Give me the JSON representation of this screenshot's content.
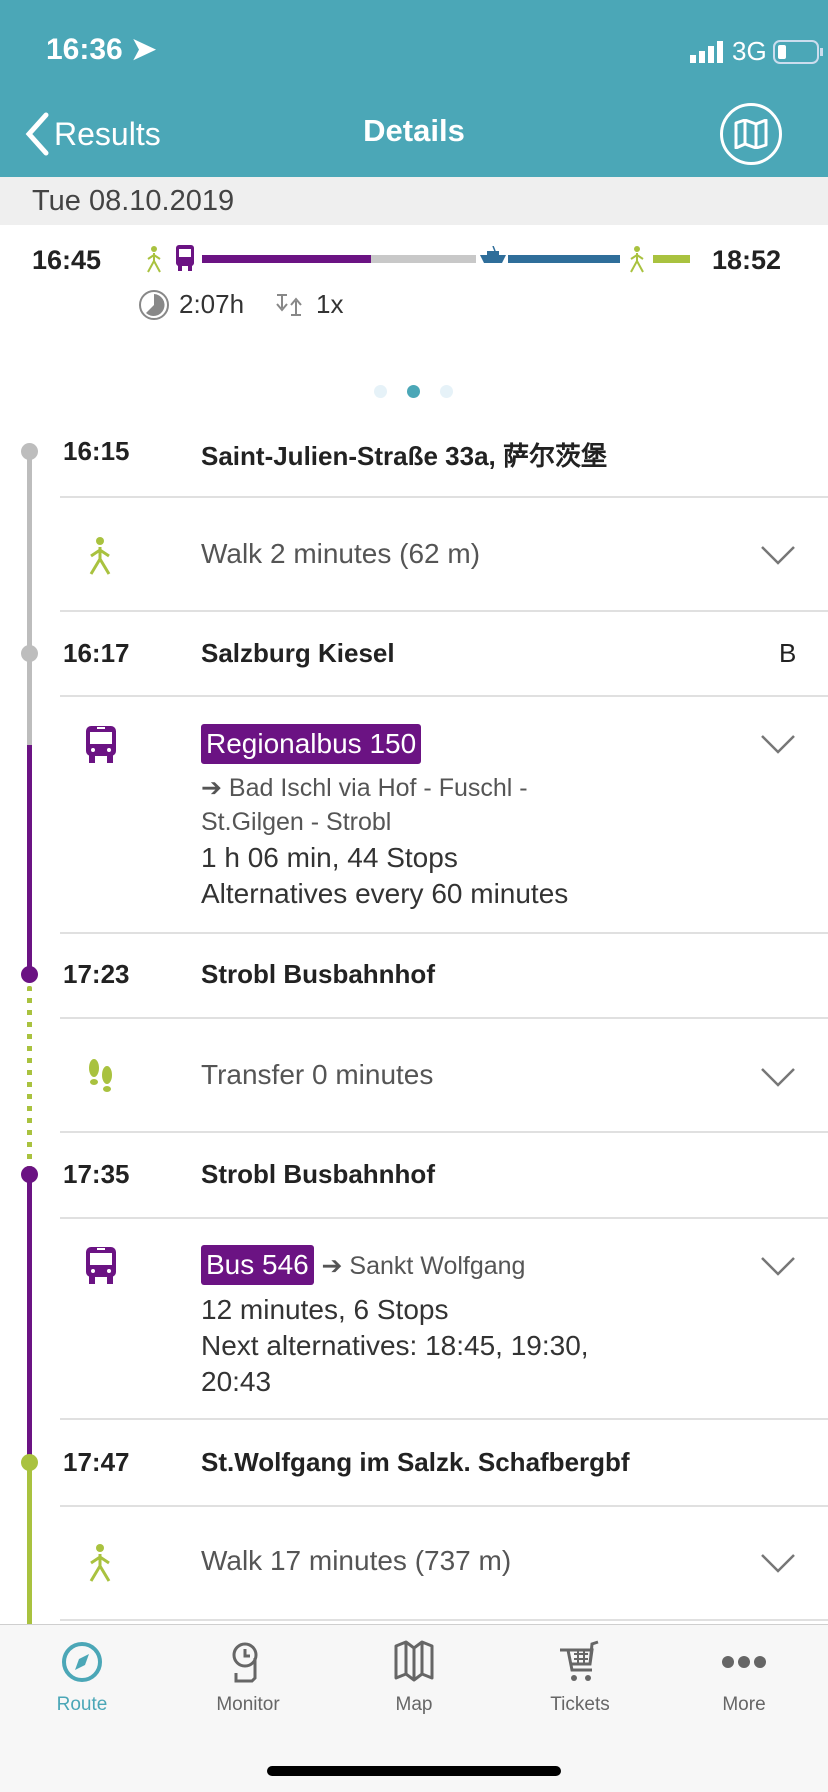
{
  "status": {
    "time": "16:36",
    "network": "3G"
  },
  "nav": {
    "back_label": "Results",
    "title": "Details",
    "map_icon": "map-icon"
  },
  "date": "Tue 08.10.2019",
  "summary": {
    "depart": "16:45",
    "arrive": "18:52",
    "duration": "2:07h",
    "transfers": "1x",
    "page_index": 1,
    "page_count": 3
  },
  "colors": {
    "header": "#4BA7B7",
    "bus": "#6B1383",
    "walk": "#A9C23F",
    "boat": "#2F6E9A",
    "waiting": "#C8C8C8"
  },
  "legs": [
    {
      "time": "16:15",
      "stop": "Saint-Julien-Straße 33a, 萨尔茨堡"
    },
    {
      "walk": "Walk 2 minutes (62 m)"
    },
    {
      "time": "16:17",
      "stop": "Salzburg Kiesel",
      "platform": "B"
    },
    {
      "line": "Regionalbus 150",
      "direction": "➔ Bad Ischl via Hof - Fuschl -",
      "direction2": "St.Gilgen - Strobl",
      "info": "1 h 06 min, 44 Stops",
      "alt": "Alternatives every 60 minutes"
    },
    {
      "time": "17:23",
      "stop": "Strobl Busbahnhof"
    },
    {
      "walk": "Transfer 0 minutes"
    },
    {
      "time": "17:35",
      "stop": "Strobl Busbahnhof"
    },
    {
      "line": "Bus 546",
      "direction": "➔ Sankt Wolfgang",
      "info": "12 minutes, 6 Stops",
      "alt": "Next alternatives: 18:45, 19:30,",
      "alt2": "20:43"
    },
    {
      "time": "17:47",
      "stop": "St.Wolfgang im Salzk. Schafbergbf"
    },
    {
      "walk": "Walk 17 minutes (737 m)"
    }
  ],
  "tabs": [
    {
      "label": "Route",
      "active": true
    },
    {
      "label": "Monitor"
    },
    {
      "label": "Map"
    },
    {
      "label": "Tickets"
    },
    {
      "label": "More"
    }
  ]
}
